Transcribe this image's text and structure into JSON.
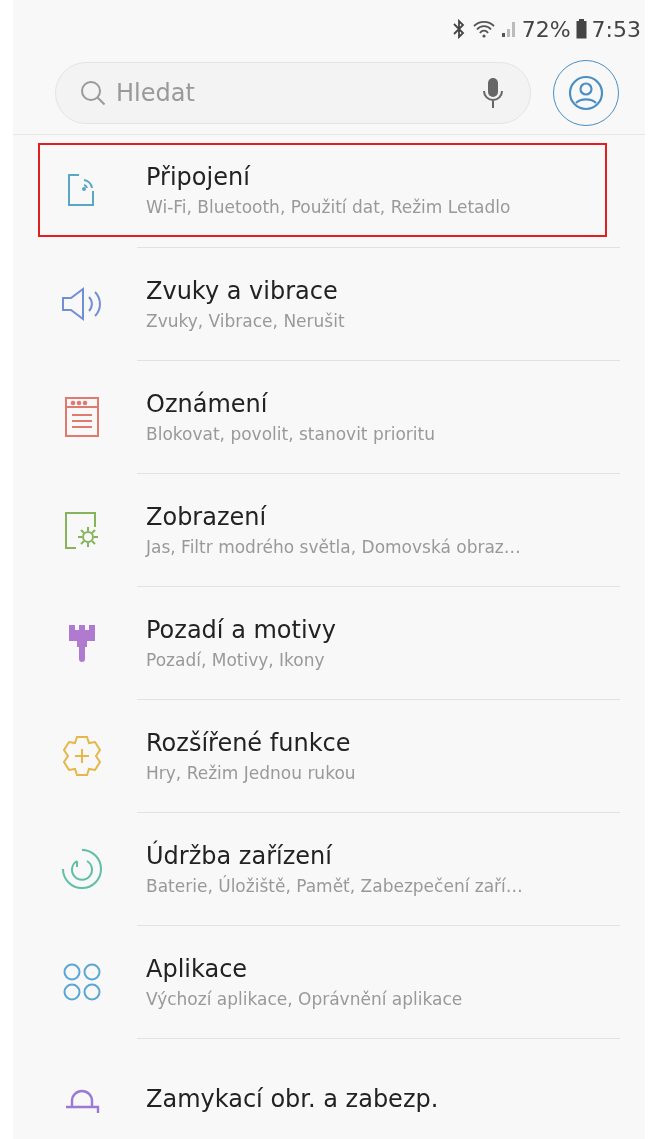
{
  "status_bar": {
    "battery_percent": "72%",
    "time": "7:53"
  },
  "search": {
    "placeholder": "Hledat"
  },
  "items": [
    {
      "kind": "connections",
      "color": "#5aa7c4",
      "title": "Připojení",
      "subtitle": "Wi-Fi, Bluetooth, Použití dat, Režim Letadlo",
      "highlighted": true
    },
    {
      "kind": "sound",
      "color": "#6f8fd6",
      "title": "Zvuky a vibrace",
      "subtitle": "Zvuky, Vibrace, Nerušit",
      "highlighted": false
    },
    {
      "kind": "notifications",
      "color": "#e07a6e",
      "title": "Oznámení",
      "subtitle": "Blokovat, povolit, stanovit prioritu",
      "highlighted": false
    },
    {
      "kind": "display",
      "color": "#86b45a",
      "title": "Zobrazení",
      "subtitle": "Jas, Filtr modrého světla, Domovská obraz…",
      "highlighted": false
    },
    {
      "kind": "themes",
      "color": "#b07ad0",
      "title": "Pozadí a motivy",
      "subtitle": "Pozadí, Motivy, Ikony",
      "highlighted": false
    },
    {
      "kind": "advanced",
      "color": "#e6b64a",
      "title": "Rozšířené funkce",
      "subtitle": "Hry, Režim Jednou rukou",
      "highlighted": false
    },
    {
      "kind": "maintenance",
      "color": "#5fbfa6",
      "title": "Údržba zařízení",
      "subtitle": "Baterie, Úložiště, Paměť, Zabezpečení zaří…",
      "highlighted": false
    },
    {
      "kind": "apps",
      "color": "#5aa7d6",
      "title": "Aplikace",
      "subtitle": "Výchozí aplikace, Oprávnění aplikace",
      "highlighted": false
    },
    {
      "kind": "lock",
      "color": "#9a7ad6",
      "title": "Zamykací obr. a zabezp.",
      "highlighted": false
    }
  ]
}
